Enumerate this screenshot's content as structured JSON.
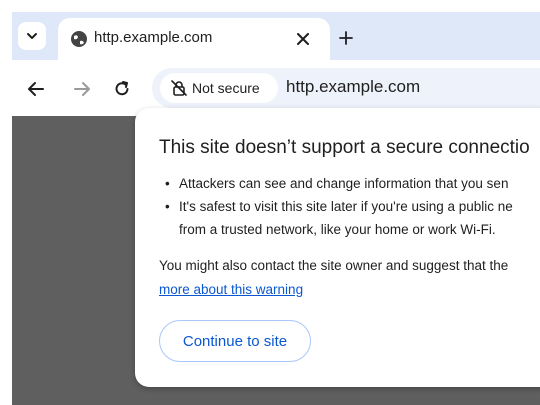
{
  "tab": {
    "title": "http.example.com"
  },
  "omnibox": {
    "security_label": "Not secure",
    "url": "http.example.com"
  },
  "dialog": {
    "title": "This site doesn’t support a secure connectio",
    "bullets": [
      "Attackers can see and change information that you sen",
      "It's safest to visit this site later if you're using a public ne",
      "from a trusted network, like your home or work Wi-Fi."
    ],
    "body_line1": "You might also contact the site owner and suggest that the",
    "learn_more_link": "more about this warning",
    "continue_button": "Continue to site"
  },
  "colors": {
    "tabstrip": "#dfe8f8",
    "page_background": "#5f5f5f",
    "accent": "#0b57d0"
  },
  "icons": [
    "chevron-down-icon",
    "globe-icon",
    "close-icon",
    "plus-icon",
    "back-arrow-icon",
    "forward-arrow-icon",
    "reload-icon",
    "not-secure-icon"
  ]
}
